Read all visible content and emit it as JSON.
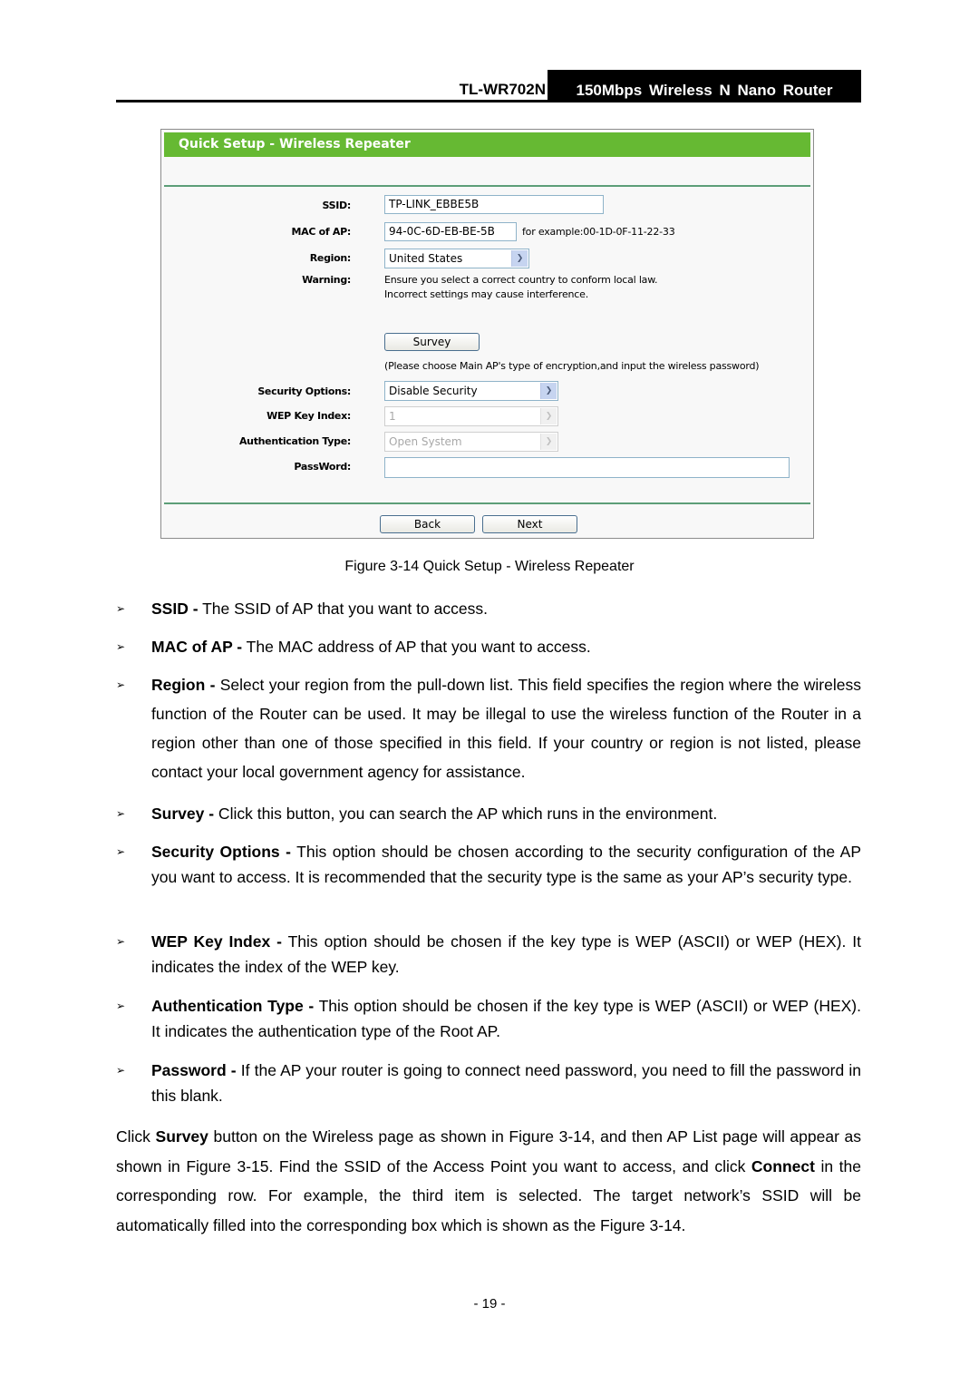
{
  "header": {
    "model": "TL-WR702N",
    "product": "150Mbps Wireless N Nano Router"
  },
  "router_ui": {
    "title": "Quick Setup - Wireless Repeater",
    "colors": {
      "title_bar": "#66b933",
      "separator": "#5c9e78",
      "input_border": "#8fb3c9"
    },
    "fields": {
      "ssid": {
        "label": "SSID:",
        "value": "TP-LINK_EBBE5B"
      },
      "mac": {
        "label": "MAC of AP:",
        "value": "94-0C-6D-EB-BE-5B",
        "hint": "for example:00-1D-0F-11-22-33"
      },
      "region": {
        "label": "Region:",
        "value": "United States"
      },
      "warning": {
        "label": "Warning:",
        "line1": "Ensure you select a correct country to conform local law.",
        "line2": "Incorrect settings may cause interference."
      },
      "survey_button": "Survey",
      "survey_note": "(Please choose Main AP's type of encryption,and input the wireless password)",
      "security": {
        "label": "Security Options:",
        "value": "Disable Security"
      },
      "wep_index": {
        "label": "WEP Key Index:",
        "value": "1"
      },
      "auth_type": {
        "label": "Authentication Type:",
        "value": "Open System"
      },
      "password": {
        "label": "PassWord:",
        "value": ""
      }
    },
    "buttons": {
      "back": "Back",
      "next": "Next"
    }
  },
  "caption": "Figure 3-14 Quick Setup - Wireless Repeater",
  "bullets": [
    {
      "term": "SSID -",
      "text": " The SSID of AP that you want to access."
    },
    {
      "term": "MAC of AP -",
      "text": " The MAC address of AP that you want to access."
    },
    {
      "term": "Region -",
      "text": " Select your region from the pull-down list. This field specifies the region where the wireless function of the Router can be used. It may be illegal to use the wireless function of the Router in a region other than one of those specified in this field. If your country or region is not listed, please contact your local government agency for assistance."
    },
    {
      "term": "Survey -",
      "text": " Click this button, you can search the AP which runs in the environment."
    },
    {
      "term": "Security Options -",
      "text": " This option should be chosen according to the security configuration of the AP you want to access. It is recommended that the security type is the same as your AP’s security type."
    },
    {
      "term": "WEP Key Index -",
      "text": " This option should be chosen if the key type is WEP (ASCII) or WEP (HEX). It indicates the index of the WEP key."
    },
    {
      "term": "Authentication Type -",
      "text": " This option should be chosen if the key type is WEP (ASCII) or WEP (HEX). It indicates the authentication type of the Root AP."
    },
    {
      "term": "Password -",
      "text": " If the AP your router is going to connect need password, you need to fill the password in this blank."
    }
  ],
  "bullet_marker": "➢",
  "paragraph": {
    "p1": "Click ",
    "b1": "Survey",
    "p2": " button on the Wireless page as shown in Figure 3-14, and then AP List page will appear as shown in Figure 3-15. Find the SSID of the Access Point you want to access, and click ",
    "b2": "Connect",
    "p3": " in the corresponding row. For example, the third item is selected. The target network’s SSID will be automatically filled into the corresponding box which is shown as the Figure 3-14."
  },
  "page_number": "- 19 -"
}
